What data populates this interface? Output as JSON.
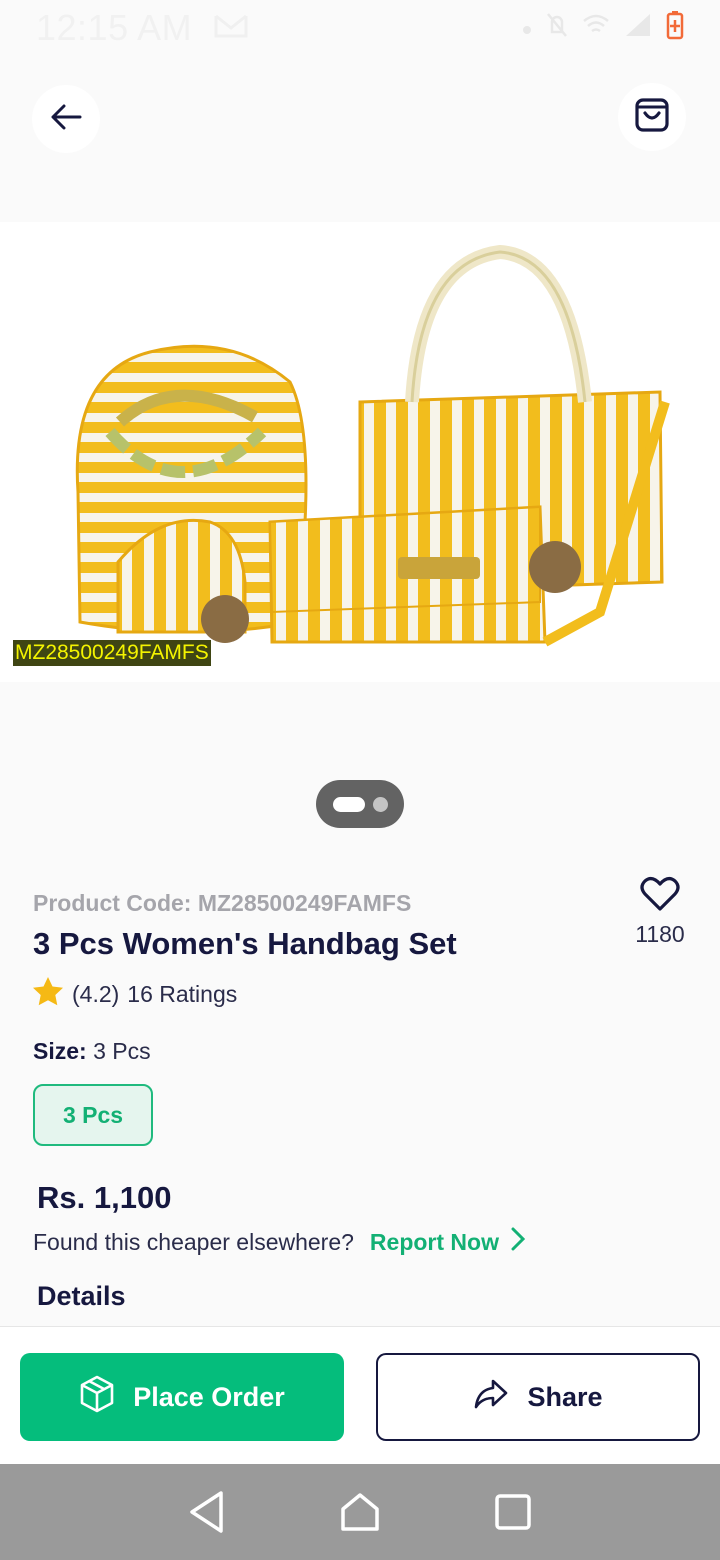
{
  "status_bar": {
    "time": "12:15 AM",
    "indicators": [
      "mail-icon",
      "dot-icon",
      "mute-icon",
      "wifi-icon",
      "signal-icon",
      "battery-charging-icon"
    ]
  },
  "nav": {
    "back_icon": "arrow-left-icon",
    "bag_icon": "shopping-bag-icon"
  },
  "hero": {
    "image_label": "MZ28500249FAMFS",
    "carousel_pages": 2,
    "carousel_active": 1
  },
  "product": {
    "code_label": "Product Code: MZ28500249FAMFS",
    "title": "3 Pcs Women's Handbag Set",
    "rating_value": "(4.2)",
    "rating_count": "16 Ratings",
    "wishlist_count": "1180",
    "size_label": "Size:",
    "size_value": "3 Pcs",
    "size_options": [
      "3 Pcs"
    ],
    "price": "Rs. 1,100",
    "cheaper_text": "Found this cheaper elsewhere?",
    "report_label": "Report Now",
    "details_heading": "Details"
  },
  "actions": {
    "place_order_label": "Place Order",
    "share_label": "Share"
  },
  "colors": {
    "accent": "#05bd7c",
    "text_dark": "#16183f",
    "star": "#f5b915",
    "bag_yellow": "#f2bd1d"
  }
}
